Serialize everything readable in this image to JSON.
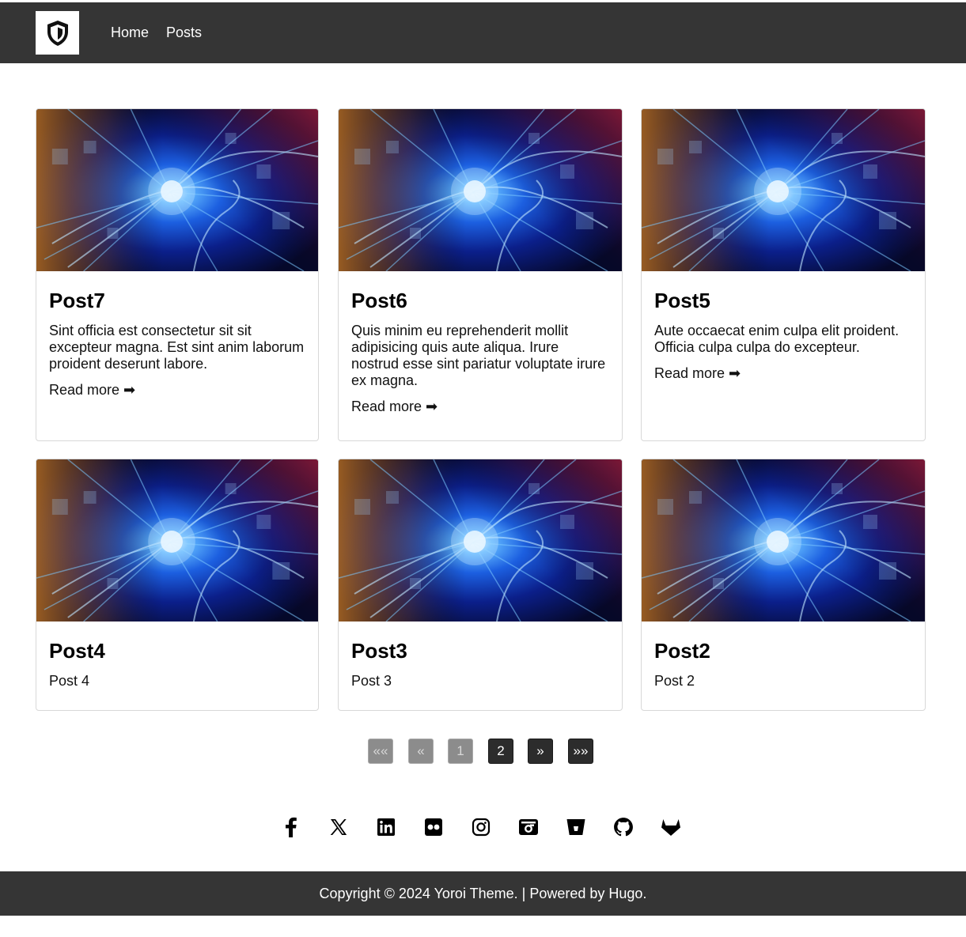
{
  "nav": {
    "home": "Home",
    "posts": "Posts"
  },
  "posts": [
    {
      "title": "Post7",
      "summary": "Sint officia est consectetur sit sit excepteur magna. Est sint anim laborum proident deserunt labore.",
      "more": "Read more ➡"
    },
    {
      "title": "Post6",
      "summary": "Quis minim eu reprehenderit mollit adipisicing quis aute aliqua. Irure nostrud esse sint pariatur voluptate irure ex magna.",
      "more": "Read more ➡"
    },
    {
      "title": "Post5",
      "summary": "Aute occaecat enim culpa elit proident. Officia culpa culpa do excepteur.",
      "more": "Read more ➡"
    },
    {
      "title": "Post4",
      "summary": "Post 4"
    },
    {
      "title": "Post3",
      "summary": "Post 3"
    },
    {
      "title": "Post2",
      "summary": "Post 2"
    }
  ],
  "pagination": {
    "first": "««",
    "prev": "«",
    "page1": "1",
    "page2": "2",
    "next": "»",
    "last": "»»",
    "current": "2"
  },
  "social": [
    "facebook",
    "x",
    "linkedin",
    "flickr",
    "instagram",
    "photo-camera",
    "bitbucket",
    "github",
    "gitlab"
  ],
  "footer": {
    "prefix": "Copyright © 2024 ",
    "theme": "Yoroi Theme",
    "middle": ". | Powered by ",
    "hugo": "Hugo",
    "suffix": "."
  },
  "colors": {
    "header": "#353535",
    "footer": "#353535",
    "active_page": "#2c2c2c",
    "disabled_page": "#8c8c8c"
  }
}
